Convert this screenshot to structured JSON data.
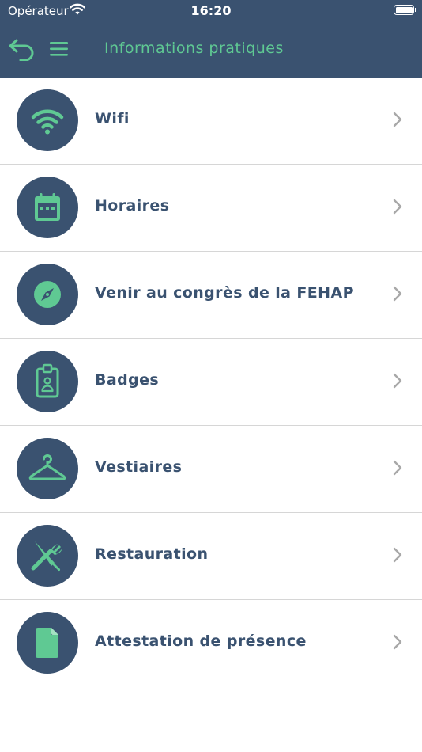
{
  "status_bar": {
    "carrier": "Opérateur",
    "time": "16:20"
  },
  "header": {
    "title": "Informations pratiques",
    "back_icon": "back-arrow-icon",
    "menu_icon": "hamburger-menu-icon"
  },
  "colors": {
    "primary": "#3a5270",
    "accent": "#5fc993",
    "chevron": "#a8a8a8",
    "divider": "#d6d6d6"
  },
  "items": [
    {
      "label": "Wifi",
      "icon": "wifi-icon"
    },
    {
      "label": "Horaires",
      "icon": "calendar-icon"
    },
    {
      "label": "Venir au congrès de la FEHAP",
      "icon": "compass-icon"
    },
    {
      "label": "Badges",
      "icon": "badge-icon"
    },
    {
      "label": "Vestiaires",
      "icon": "hanger-icon"
    },
    {
      "label": "Restauration",
      "icon": "cutlery-icon"
    },
    {
      "label": "Attestation de présence",
      "icon": "document-icon"
    }
  ]
}
